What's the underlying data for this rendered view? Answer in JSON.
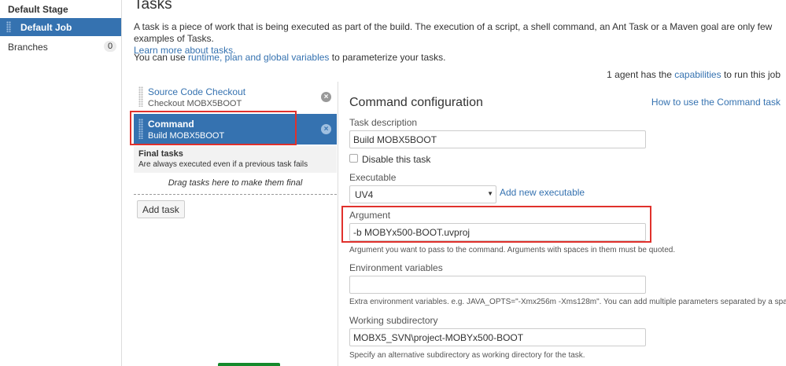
{
  "sidebar": {
    "stage_title": "Default Stage",
    "job_label": "Default Job",
    "branches_label": "Branches",
    "branches_count": "0"
  },
  "header": {
    "title": "Tasks",
    "intro": "A task is a piece of work that is being executed as part of the build. The execution of a script, a shell command, an Ant Task or a Maven goal are only few examples of Tasks.",
    "learn_more": "Learn more about tasks.",
    "vars_prefix": "You can use",
    "vars_link": "runtime, plan and global variables",
    "vars_suffix": "to parameterize your tasks.",
    "agent_prefix": "1 agent has the",
    "agent_link": "capabilities",
    "agent_suffix": "to run this job"
  },
  "tasks": [
    {
      "name": "Source Code Checkout",
      "sub": "Checkout MOBX5BOOT"
    },
    {
      "name": "Command",
      "sub": "Build MOBX5BOOT"
    }
  ],
  "final_tasks": {
    "title": "Final tasks",
    "subtitle": "Are always executed even if a previous task fails",
    "drag_hint": "Drag tasks here to make them final",
    "add_task": "Add task"
  },
  "config": {
    "title": "Command configuration",
    "help_link": "How to use the Command task",
    "task_description_label": "Task description",
    "task_description_value": "Build MOBX5BOOT",
    "disable_label": "Disable this task",
    "executable_label": "Executable",
    "executable_value": "UV4",
    "add_executable": "Add new executable",
    "argument_label": "Argument",
    "argument_value": "-b MOBYx500-BOOT.uvproj",
    "argument_hint": "Argument you want to pass to the command. Arguments with spaces in them must be quoted.",
    "env_label": "Environment variables",
    "env_value": "",
    "env_hint": "Extra environment variables. e.g. JAVA_OPTS=\"-Xmx256m -Xms128m\". You can add multiple parameters separated by a space.",
    "workdir_label": "Working subdirectory",
    "workdir_value": "MOBX5_SVN\\project-MOBYx500-BOOT",
    "workdir_hint": "Specify an alternative subdirectory as working directory for the task."
  },
  "colors": {
    "accent": "#3572b0",
    "highlight": "#e0312c",
    "success": "#14892c"
  },
  "icons": {
    "remove": "close-circle-icon",
    "grip": "drag-handle-icon",
    "dropdown": "chevron-down-icon"
  }
}
